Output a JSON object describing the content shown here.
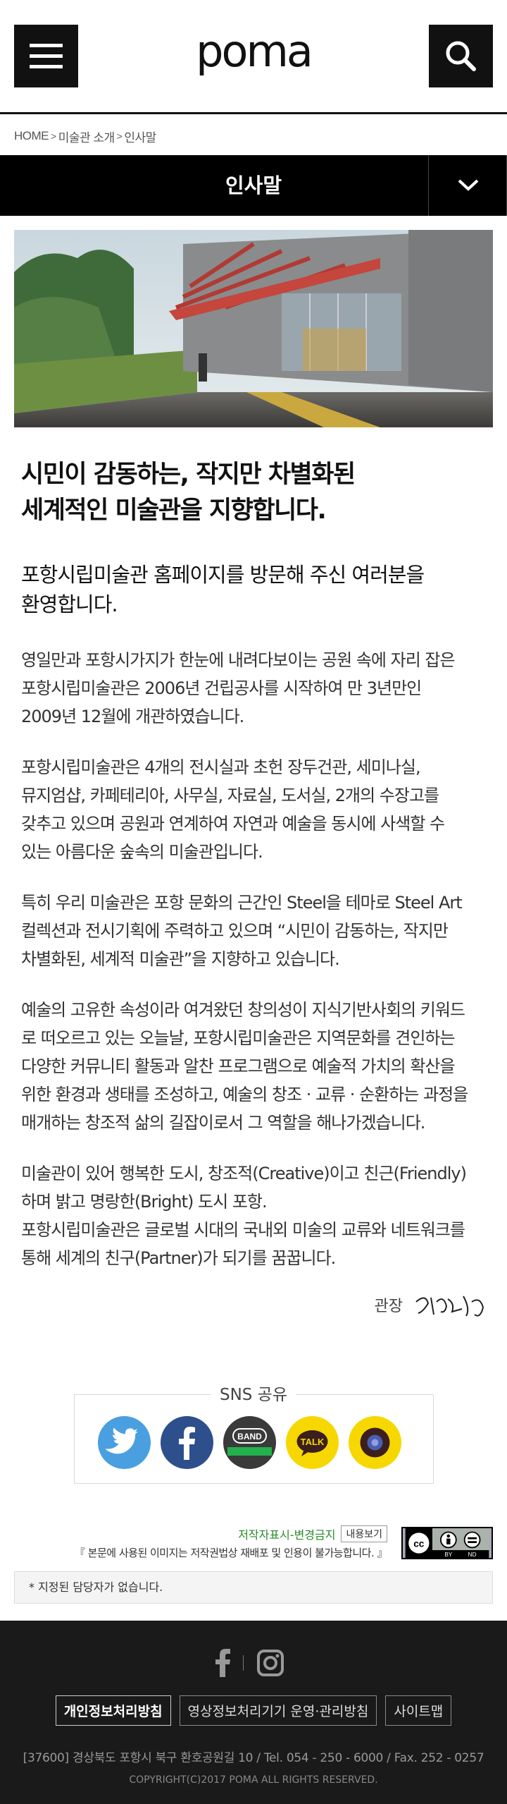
{
  "header": {
    "logo_text": "poma",
    "menu_icon": "hamburger-menu-icon",
    "search_icon": "search-icon"
  },
  "breadcrumb": {
    "items": [
      "HOME",
      "미술관 소개",
      "인사말"
    ]
  },
  "title_bar": {
    "title": "인사말",
    "dropdown_icon": "chevron-down-icon"
  },
  "content": {
    "headline_line1": "시민이 감동하는, 작지만 차별화된",
    "headline_line2": "세계적인 미술관을 지향합니다.",
    "subhead_line1": "포항시립미술관 홈페이지를 방문해 주신 여러분을",
    "subhead_line2": "환영합니다.",
    "paragraphs": [
      "영일만과 포항시가지가 한눈에 내려다보이는 공원 속에 자리 잡은\n포항시립미술관은 2006년 건립공사를 시작하여 만 3년만인\n2009년 12월에 개관하였습니다.",
      "포항시립미술관은 4개의 전시실과 초헌 장두건관, 세미나실,\n뮤지엄샵, 카페테리아, 사무실, 자료실, 도서실, 2개의 수장고를\n갖추고 있으며 공원과 연계하여 자연과 예술을 동시에 사색할 수\n있는 아름다운 숲속의 미술관입니다.",
      "특히 우리 미술관은 포항 문화의 근간인 Steel을 테마로 Steel Art\n컬렉션과 전시기획에 주력하고 있으며 “시민이 감동하는, 작지만\n차별화된, 세계적 미술관”을 지향하고 있습니다.",
      "예술의 고유한 속성이라 여겨왔던 창의성이 지식기반사회의 키워드\n로 떠오르고 있는 오늘날, 포항시립미술관은 지역문화를 견인하는\n다양한 커뮤니티 활동과 알찬 프로그램으로 예술적 가치의 확산을\n위한 환경과 생태를 조성하고, 예술의 창조 · 교류 · 순환하는 과정을\n매개하는 창조적 삶의 길잡이로서 그 역할을 해나가겠습니다.",
      "미술관이 있어 행복한 도시, 창조적(Creative)이고 친근(Friendly)\n하며 밝고 명랑한(Bright) 도시 포항.\n포항시립미술관은 글로벌 시대의 국내외 미술의 교류와 네트워크를\n통해 세계의 친구(Partner)가 되기를 꿈꿉니다."
    ],
    "signature_label": "관장"
  },
  "sns": {
    "title": "SNS 공유",
    "items": [
      {
        "name": "twitter-icon",
        "color": "#4a9fe0"
      },
      {
        "name": "facebook-icon",
        "color": "#2d4f8c"
      },
      {
        "name": "band-icon",
        "label": "BAND",
        "color": "#3a3a3a"
      },
      {
        "name": "kakaotalk-icon",
        "label": "TALK",
        "color": "#f6d800"
      },
      {
        "name": "kakaostory-icon",
        "color": "#f6d800"
      }
    ]
  },
  "license": {
    "label": "저작자표시-변경금지",
    "more_button": "내용보기",
    "notice": "『 본문에 사용된 이미지는 저작권법상 재배포 및 인용이 불가능합니다. 』",
    "cc_terms": [
      "BY",
      "ND"
    ]
  },
  "manager_notice": "* 지정된 담당자가 없습니다.",
  "footer": {
    "links": [
      "개인정보처리방침",
      "영상정보처리기기 운영·관리방침",
      "사이트맵"
    ],
    "address": "[37600] 경상북도 포항시 북구 환호공원길 10 / Tel. 054 - 250 - 6000  / Fax. 252 - 0257",
    "copyright": "COPYRIGHT(C)2017 POMA ALL RIGHTS RESERVED."
  }
}
